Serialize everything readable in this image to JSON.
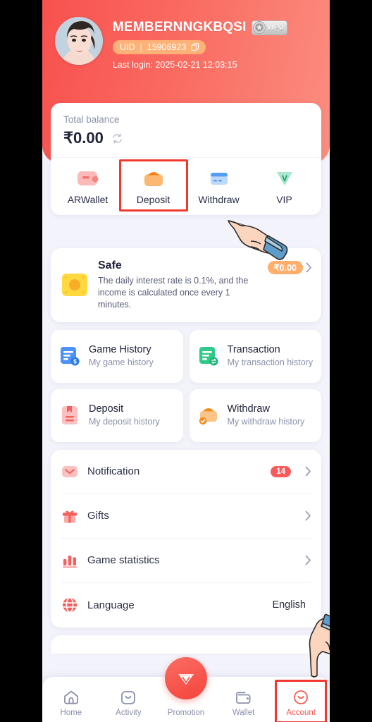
{
  "header": {
    "username": "MEMBERNNGKBQSI",
    "vip_level_label": "VIP0",
    "uid_label": "UID",
    "uid_separator": "|",
    "uid_value": "15906923",
    "last_login": "Last login: 2025-02-21 12:03:15",
    "gradient_start": "#f8514e",
    "gradient_end": "#fb8d80"
  },
  "balance": {
    "label": "Total balance",
    "amount": "₹0.00",
    "actions": [
      {
        "label": "ARWallet",
        "icon": "wallet-icon",
        "highlighted": false
      },
      {
        "label": "Deposit",
        "icon": "deposit-bag-icon",
        "highlighted": true
      },
      {
        "label": "Withdraw",
        "icon": "withdraw-card-icon",
        "highlighted": false
      },
      {
        "label": "VIP",
        "icon": "vip-gem-icon",
        "highlighted": false
      }
    ]
  },
  "safe": {
    "title": "Safe",
    "description": "The daily interest rate is 0.1%, and the income is calculated once every 1 minutes.",
    "amount": "₹0.00",
    "badge_color": "#ffae6b"
  },
  "grid": [
    {
      "title": "Game History",
      "subtitle": "My game history",
      "icon": "game-history-icon",
      "color": "#4d92f8"
    },
    {
      "title": "Transaction",
      "subtitle": "My transaction history",
      "icon": "transaction-icon",
      "color": "#2fc98a"
    },
    {
      "title": "Deposit",
      "subtitle": "My deposit history",
      "icon": "deposit-history-icon",
      "color": "#f98a8a"
    },
    {
      "title": "Withdraw",
      "subtitle": "My withdraw history",
      "icon": "withdraw-history-icon",
      "color": "#fba24c"
    }
  ],
  "menu": [
    {
      "label": "Notification",
      "icon": "mail-icon",
      "badge": "14",
      "value": ""
    },
    {
      "label": "Gifts",
      "icon": "gift-icon",
      "badge": "",
      "value": ""
    },
    {
      "label": "Game statistics",
      "icon": "bar-chart-icon",
      "badge": "",
      "value": ""
    },
    {
      "label": "Language",
      "icon": "globe-icon",
      "badge": "",
      "value": "English"
    }
  ],
  "navbar": {
    "items": [
      {
        "label": "Home",
        "icon": "home-icon",
        "active": false
      },
      {
        "label": "Activity",
        "icon": "activity-icon",
        "active": false
      },
      {
        "label": "Promotion",
        "icon": "promotion-diamond-icon",
        "active": false
      },
      {
        "label": "Wallet",
        "icon": "wallet-nav-icon",
        "active": false
      },
      {
        "label": "Account",
        "icon": "account-icon",
        "active": true
      }
    ],
    "active_color": "#f85a52",
    "inactive_color": "#8b90a8"
  },
  "cursors": [
    {
      "name": "pointing-hand-deposit",
      "direction": "up-left"
    },
    {
      "name": "pointing-hand-account",
      "direction": "down"
    }
  ]
}
